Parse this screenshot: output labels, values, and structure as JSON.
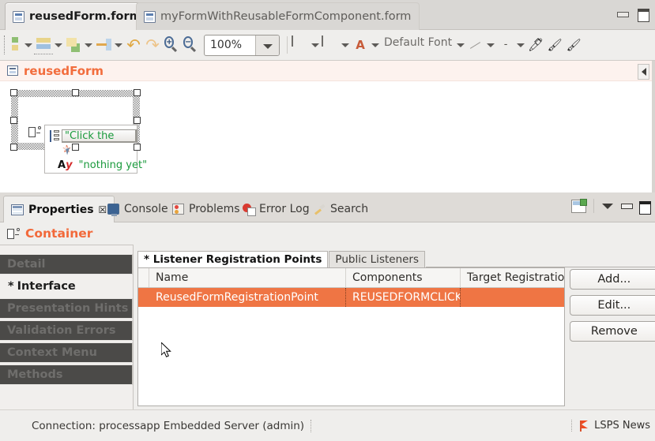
{
  "window": {
    "minimize_label": "Minimize",
    "maximize_label": "Maximize"
  },
  "editor_tabs": [
    {
      "label": "reusedForm.form",
      "icon": "form-file-icon",
      "active": true,
      "close_glyph": "☒"
    },
    {
      "label": "myFormWithReusableFormComponent.form",
      "icon": "form-file-icon",
      "active": false
    }
  ],
  "toolbar": {
    "items": [
      {
        "name": "align-components",
        "icon": "align-icon",
        "has_dropdown": true
      },
      {
        "name": "distribute-components",
        "icon": "distribute-icon",
        "has_dropdown": true
      },
      {
        "name": "set-size",
        "icon": "size-icon",
        "has_dropdown": true
      },
      {
        "name": "match-width",
        "icon": "match-icon",
        "has_dropdown": true
      },
      {
        "name": "undo",
        "icon": "undo-arrow-icon",
        "glyph": "↶"
      },
      {
        "name": "redo",
        "icon": "redo-arrow-icon",
        "glyph": "↷"
      },
      {
        "name": "zoom-in",
        "icon": "zoom-in-icon",
        "glyph": "+"
      },
      {
        "name": "zoom-out",
        "icon": "zoom-out-icon",
        "glyph": "−"
      }
    ],
    "zoom_value": "100%",
    "font_name": "Default Font",
    "font_letter_glyph": "A",
    "dash_glyph": "-",
    "color_picker_glyph": "🖊",
    "fill_brush_glyph": "🖌",
    "clear_brush_glyph": "🖌"
  },
  "editor": {
    "form_title": "reusedForm",
    "form_icon": "form-icon",
    "collapse_arrow": "collapse-left-arrow",
    "canvas": {
      "container_icon": "container-icon",
      "button_icon": "list-button-icon",
      "button_text": "\"Click the",
      "click_icon": "click-action-icon",
      "label_icon_a": "A",
      "label_icon_y": "y",
      "label_text": "\"nothing yet\""
    }
  },
  "view_tabs": [
    {
      "label": "Properties",
      "icon": "properties-icon",
      "active": true,
      "close_glyph": "☒"
    },
    {
      "label": "Console",
      "icon": "console-icon",
      "active": false
    },
    {
      "label": "Problems",
      "icon": "problems-icon",
      "active": false
    },
    {
      "label": "Error Log",
      "icon": "error-log-icon",
      "active": false
    },
    {
      "label": "Search",
      "icon": "search-icon",
      "active": false
    }
  ],
  "view_actions": [
    {
      "name": "new-properties-view",
      "icon": "new-view-icon"
    },
    {
      "name": "view-menu",
      "icon": "chevron-down-icon"
    },
    {
      "name": "minimize-view",
      "icon": "minimize-icon"
    },
    {
      "name": "maximize-view",
      "icon": "maximize-icon"
    }
  ],
  "properties": {
    "header_title": "Container",
    "header_icon": "container-icon",
    "sections": [
      {
        "label": "Detail",
        "selected": false,
        "dirty": false
      },
      {
        "label": "Interface",
        "selected": true,
        "dirty": true,
        "star": "*"
      },
      {
        "label": "Presentation Hints",
        "selected": false,
        "dirty": false
      },
      {
        "label": "Validation Errors",
        "selected": false,
        "dirty": false
      },
      {
        "label": "Context Menu",
        "selected": false,
        "dirty": false
      },
      {
        "label": "Methods",
        "selected": false,
        "dirty": false
      }
    ],
    "inner_tabs": [
      {
        "label": "* Listener Registration Points",
        "active": true
      },
      {
        "label": "Public Listeners",
        "active": false
      }
    ],
    "table": {
      "columns": [
        "",
        "Name",
        "Components",
        "Target Registratio"
      ],
      "rows": [
        {
          "cells": [
            "",
            "ReusedFormRegistrationPoint",
            "REUSEDFORMCLICKE",
            ""
          ],
          "selected": true
        }
      ]
    },
    "buttons": [
      {
        "label": "Add..."
      },
      {
        "label": "Edit..."
      },
      {
        "label": "Remove"
      }
    ]
  },
  "statusbar": {
    "connection": "Connection: processapp Embedded Server (admin)",
    "news_label": "LSPS News",
    "news_icon": "flag-icon"
  },
  "colors": {
    "accent_orange": "#f2693a",
    "selection_orange": "#ef7544",
    "green_text": "#1a9a3c",
    "window_bg": "#efeeec"
  }
}
